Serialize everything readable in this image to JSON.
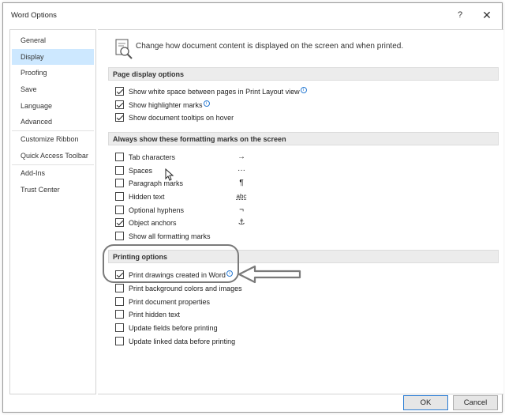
{
  "window": {
    "title": "Word Options",
    "help_label": "?",
    "close_label": "✕"
  },
  "sidebar": {
    "items": [
      {
        "label": "General"
      },
      {
        "label": "Display",
        "selected": true
      },
      {
        "label": "Proofing"
      },
      {
        "label": "Save"
      },
      {
        "label": "Language"
      },
      {
        "label": "Advanced"
      },
      {
        "label": "Customize Ribbon"
      },
      {
        "label": "Quick Access Toolbar"
      },
      {
        "label": "Add-Ins"
      },
      {
        "label": "Trust Center"
      }
    ]
  },
  "main": {
    "header": "Change how document content is displayed on the screen and when printed.",
    "page_display": {
      "title": "Page display options",
      "options": [
        {
          "label": "Show white space between pages in Print Layout view",
          "checked": true,
          "info": true
        },
        {
          "label": "Show highlighter marks",
          "checked": true,
          "info": true
        },
        {
          "label": "Show document tooltips on hover",
          "checked": true,
          "info": false
        }
      ]
    },
    "formatting_marks": {
      "title": "Always show these formatting marks on the screen",
      "options": [
        {
          "label": "Tab characters",
          "checked": false,
          "symbol": "→"
        },
        {
          "label": "Spaces",
          "checked": false,
          "symbol": "···"
        },
        {
          "label": "Paragraph marks",
          "checked": false,
          "symbol": "¶"
        },
        {
          "label": "Hidden text",
          "checked": false,
          "symbol": "abc"
        },
        {
          "label": "Optional hyphens",
          "checked": false,
          "symbol": "¬"
        },
        {
          "label": "Object anchors",
          "checked": true,
          "symbol": "⚓"
        },
        {
          "label": "Show all formatting marks",
          "checked": false,
          "symbol": ""
        }
      ]
    },
    "printing": {
      "title": "Printing options",
      "options": [
        {
          "label": "Print drawings created in Word",
          "checked": true,
          "info": true
        },
        {
          "label": "Print background colors and images",
          "checked": false,
          "info": false
        },
        {
          "label": "Print document properties",
          "checked": false,
          "info": false
        },
        {
          "label": "Print hidden text",
          "checked": false,
          "info": false
        },
        {
          "label": "Update fields before printing",
          "checked": false,
          "info": false
        },
        {
          "label": "Update linked data before printing",
          "checked": false,
          "info": false
        }
      ]
    }
  },
  "footer": {
    "ok_label": "OK",
    "cancel_label": "Cancel"
  },
  "colors": {
    "selected_nav": "#cde8ff",
    "accent": "#2b7cd3",
    "section_bg": "#ececec",
    "annotation": "#7a7a7a"
  }
}
